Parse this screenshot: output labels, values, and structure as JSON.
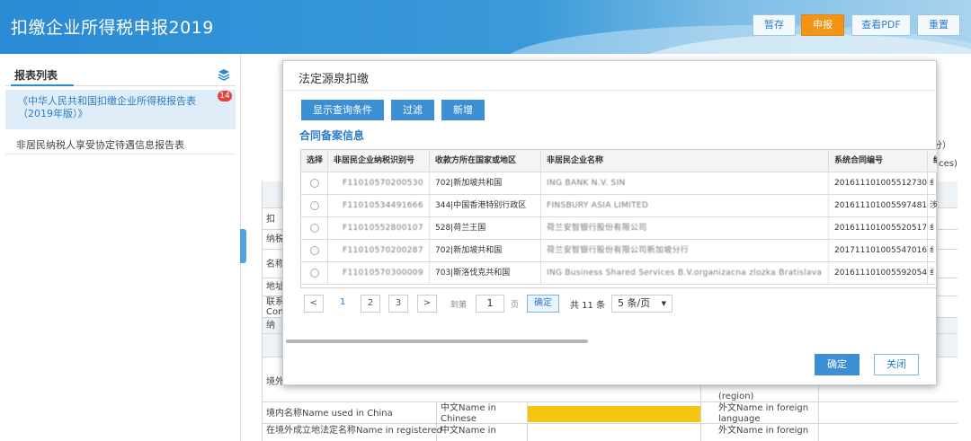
{
  "header": {
    "title": "扣缴企业所得税申报2019",
    "buttons": [
      "暂存",
      "申报",
      "查看PDF",
      "重置"
    ]
  },
  "sidebar": {
    "title": "报表列表",
    "items": [
      {
        "label": "《中华人民共和国扣缴企业所得税报告表（2019年版）》",
        "badge": "14"
      },
      {
        "label": "非居民纳税人享受协定待遇信息报告表"
      }
    ]
  },
  "background_form": {
    "right_hints": [
      "分）",
      "aces)"
    ],
    "left_labels": [
      "扣",
      "纳税",
      "名称",
      "地址",
      "联系",
      "Con",
      "纳",
      "境外"
    ],
    "row_name_china": "境内名称Name used in China",
    "row_name_registered": "在境外成立地法定名称Name in registered",
    "chinese_label_1": "中文Name in Chinese",
    "chinese_label_2": "中文Name in",
    "foreign_label_1": "外文Name in foreign language",
    "foreign_label_2": "外文Name in foreign",
    "region_label": "(region)"
  },
  "modal": {
    "title": "法定源泉扣缴",
    "toolbar": [
      "显示查询条件",
      "过滤",
      "新增"
    ],
    "section_title": "合同备案信息",
    "columns": [
      "选择",
      "非居民企业纳税识别号",
      "收款方所在国家或地区",
      "非居民企业名称",
      "系统合同编号",
      "纳"
    ],
    "rows": [
      {
        "taxid": "F11010570200530",
        "country": "702|新加坡共和国",
        "name": "ING BANK N.V. SIN",
        "contract": "201611101005512730",
        "extra": "纟"
      },
      {
        "taxid": "F11010534491666",
        "country": "344|中国香港特别行政区",
        "name": "FINSBURY ASIA LIMITED",
        "contract": "201611101005597481",
        "extra": "涉"
      },
      {
        "taxid": "F11010552800107",
        "country": "528|荷兰王国",
        "name": "荷兰安智银行股份有限公司",
        "contract": "201611101005520517",
        "extra": "纟"
      },
      {
        "taxid": "F11010570200287",
        "country": "702|新加坡共和国",
        "name": "荷兰安智银行股份有限公司新加坡分行",
        "contract": "201711101005547016",
        "extra": "纟"
      },
      {
        "taxid": "F11010570300009",
        "country": "703|斯洛伐克共和国",
        "name": "ING Business Shared Services B.V.organizacna zlozka Bratislava",
        "contract": "201611101005592054",
        "extra": "纟"
      }
    ],
    "pager": {
      "prev": "<",
      "pages": [
        "1",
        "2",
        "3"
      ],
      "next": ">",
      "goto_label": "到第",
      "current_page": "1",
      "page_suffix": "页",
      "confirm": "确定",
      "total": "共 11 条",
      "page_size": "5 条/页"
    },
    "footer": {
      "ok": "确定",
      "close": "关闭"
    }
  },
  "colors": {
    "header_blue": "#2a8bd5",
    "accent_orange": "#f29516",
    "primary_blue": "#3c8fd2",
    "badge_red": "#e2443a",
    "highlight_yellow": "#f3c612"
  }
}
